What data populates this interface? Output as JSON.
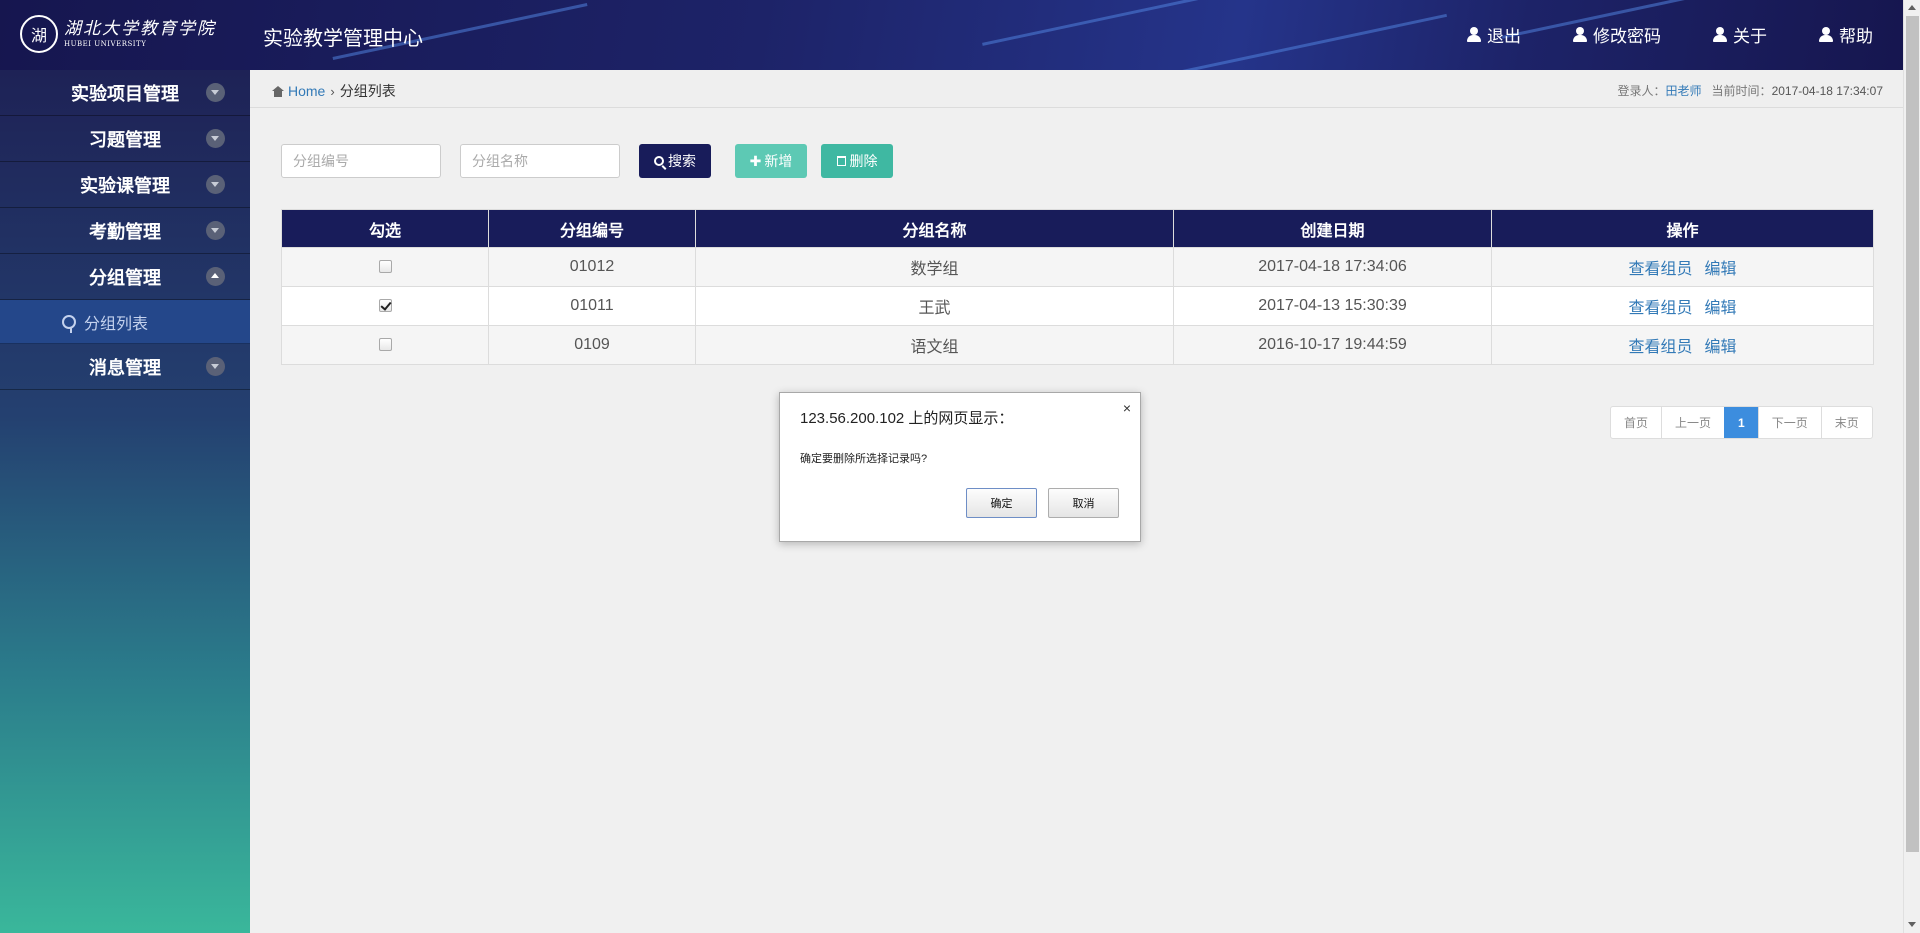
{
  "header": {
    "logo_cn": "湖北大学教育学院",
    "logo_en": "HUBEI UNIVERSITY",
    "app_title": "实验教学管理中心",
    "nav": [
      {
        "label": "退出",
        "icon": "user-icon"
      },
      {
        "label": "修改密码",
        "icon": "user-icon"
      },
      {
        "label": "关于",
        "icon": "user-icon"
      },
      {
        "label": "帮助",
        "icon": "user-icon"
      }
    ]
  },
  "sidebar": {
    "items": [
      {
        "label": "实验项目管理",
        "expanded": false
      },
      {
        "label": "习题管理",
        "expanded": false
      },
      {
        "label": "实验课管理",
        "expanded": false
      },
      {
        "label": "考勤管理",
        "expanded": false
      },
      {
        "label": "分组管理",
        "expanded": true,
        "children": [
          {
            "label": "分组列表",
            "active": true
          }
        ]
      },
      {
        "label": "消息管理",
        "expanded": false
      }
    ]
  },
  "breadcrumb": {
    "home": "Home",
    "current": "分组列表"
  },
  "login_info": {
    "user_label": "登录人：",
    "user": "田老师",
    "time_label": "当前时间：",
    "time": "2017-04-18 17:34:07"
  },
  "toolbar": {
    "group_no_placeholder": "分组编号",
    "group_name_placeholder": "分组名称",
    "search_label": "搜索",
    "add_label": "新增",
    "delete_label": "删除",
    "colors": {
      "search": "#181c5a",
      "add": "#5dc9b4",
      "delete": "#3fb8a2"
    }
  },
  "table": {
    "headers": [
      "勾选",
      "分组编号",
      "分组名称",
      "创建日期",
      "操作"
    ],
    "rows": [
      {
        "checked": false,
        "no": "01012",
        "name": "数学组",
        "date": "2017-04-18 17:34:06",
        "actions": [
          "查看组员",
          "编辑"
        ]
      },
      {
        "checked": true,
        "no": "01011",
        "name": "王武",
        "date": "2017-04-13 15:30:39",
        "actions": [
          "查看组员",
          "编辑"
        ]
      },
      {
        "checked": false,
        "no": "0109",
        "name": "语文组",
        "date": "2016-10-17 19:44:59",
        "actions": [
          "查看组员",
          "编辑"
        ]
      }
    ]
  },
  "pagination": {
    "first": "首页",
    "prev": "上一页",
    "current": "1",
    "next": "下一页",
    "last": "末页"
  },
  "dialog": {
    "title": "123.56.200.102 上的网页显示：",
    "close": "×",
    "message": "确定要删除所选择记录吗?",
    "ok": "确定",
    "cancel": "取消"
  }
}
